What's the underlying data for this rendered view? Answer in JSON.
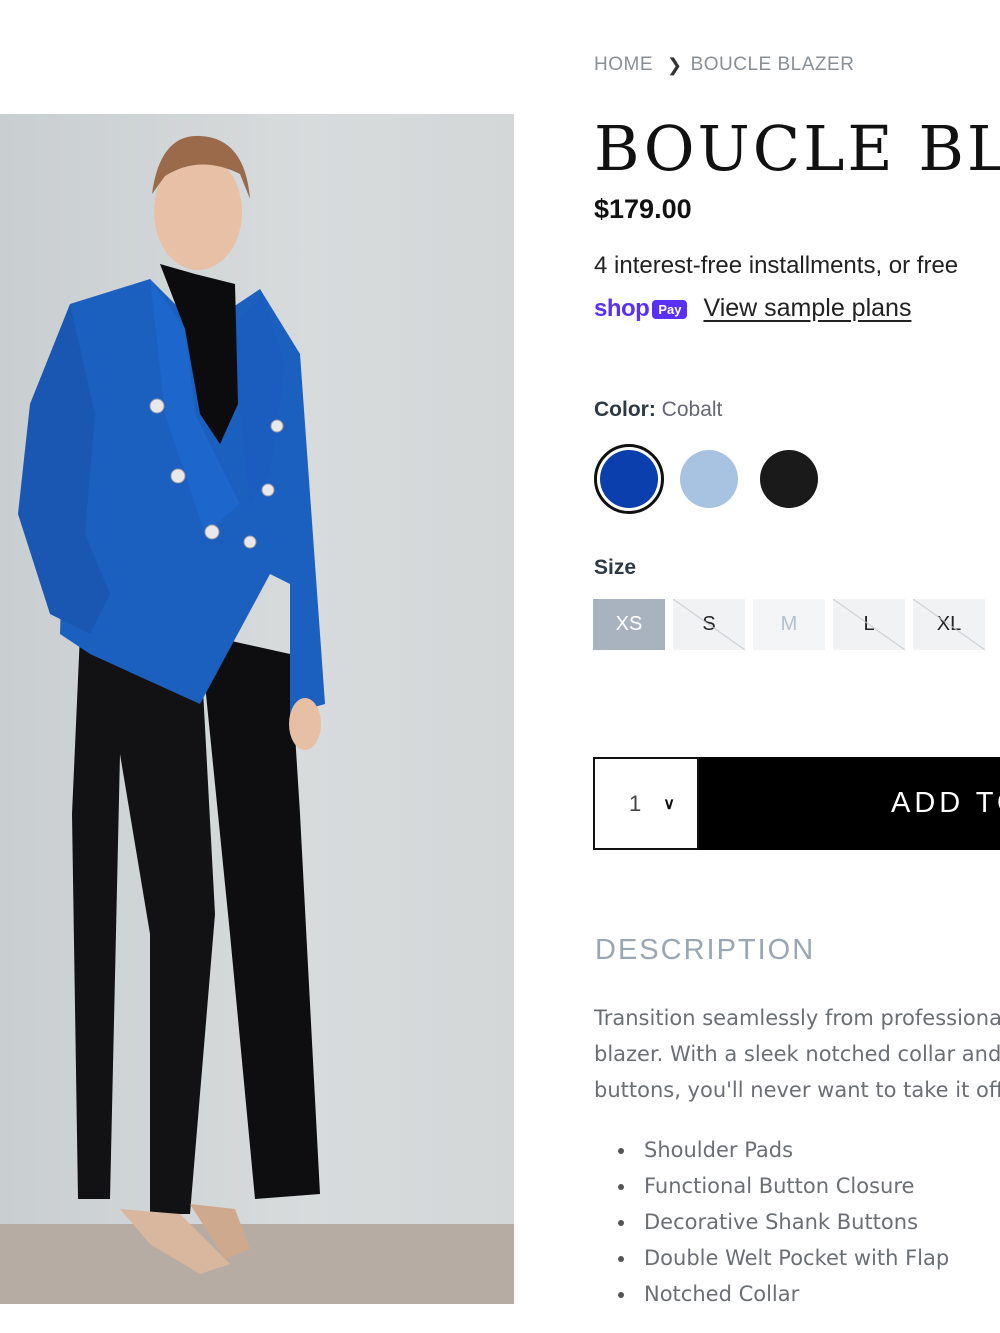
{
  "breadcrumb": {
    "home": "HOME",
    "current": "BOUCLE BLAZER"
  },
  "product": {
    "title": "BOUCLE BLAZER",
    "price": "$179.00",
    "installments_text": "4 interest-free installments, or free",
    "shop_pay": {
      "shop": "shop",
      "pay": "Pay",
      "link": "View sample plans"
    }
  },
  "color": {
    "label": "Color:",
    "selected": "Cobalt",
    "swatches": [
      {
        "name": "Cobalt",
        "hex": "#0b3fae",
        "selected": true
      },
      {
        "name": "Light Blue",
        "hex": "#a8c3e2",
        "selected": false
      },
      {
        "name": "Black",
        "hex": "#1a1a1a",
        "selected": false
      }
    ]
  },
  "size": {
    "label": "Size",
    "options": [
      {
        "label": "XS",
        "state": "selected"
      },
      {
        "label": "S",
        "state": "unavailable"
      },
      {
        "label": "M",
        "state": "light"
      },
      {
        "label": "L",
        "state": "unavailable"
      },
      {
        "label": "XL",
        "state": "unavailable"
      }
    ]
  },
  "cart": {
    "quantity": "1",
    "add_button": "ADD TO CART"
  },
  "description": {
    "title": "DESCRIPTION",
    "lines": [
      "Transition seamlessly from professional",
      "blazer. With a sleek notched collar and",
      "buttons, you'll never want to take it off"
    ],
    "features": [
      "Shoulder Pads",
      "Functional Button Closure",
      "Decorative Shank Buttons",
      "Double Welt Pocket with Flap",
      "Notched Collar"
    ]
  },
  "colors": {
    "accent": "#000000",
    "shop_pay": "#5a31f4",
    "selected_size_bg": "#a8b3bf",
    "description_heading": "#9aa6b3"
  }
}
